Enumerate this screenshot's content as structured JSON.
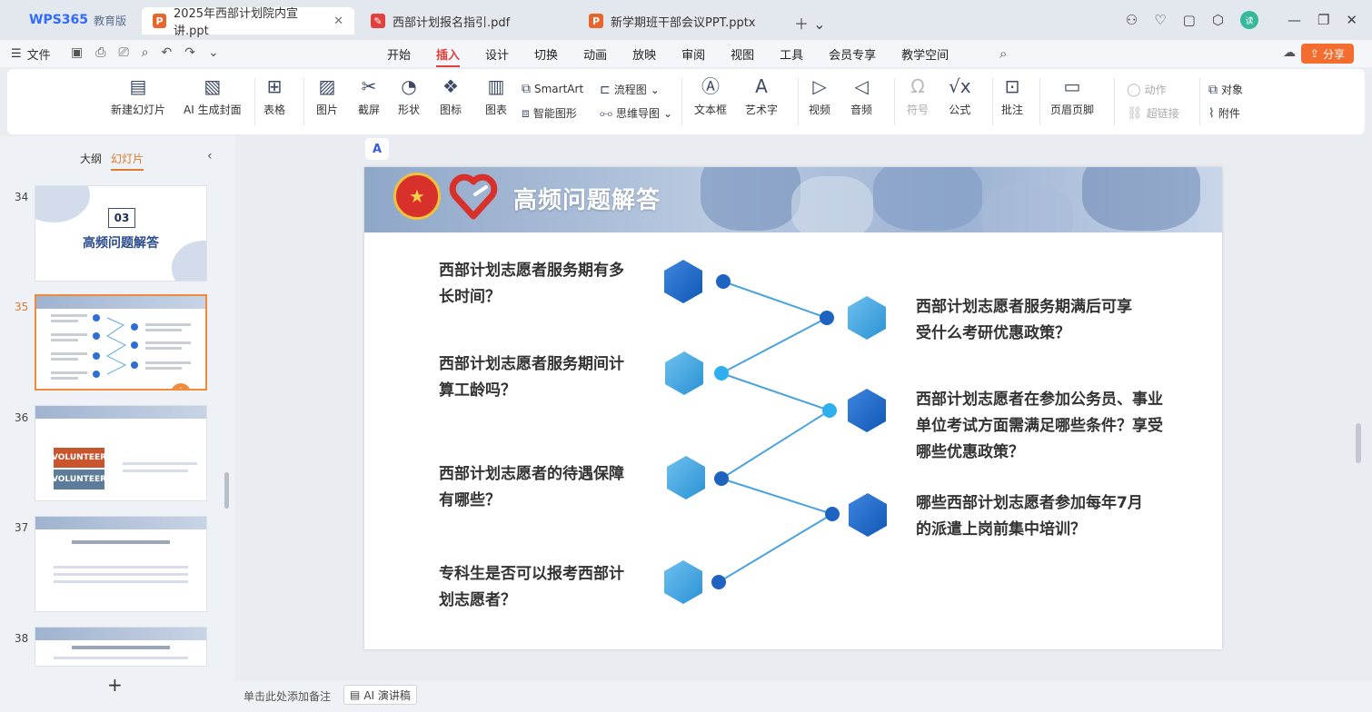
{
  "tabs": {
    "brand": "WPS365",
    "brand_sub": "教育版",
    "docs": [
      {
        "label": "2025年西部计划院内宣讲.ppt",
        "type": "P"
      },
      {
        "label": "西部计划报名指引.pdf",
        "type": "pdf"
      },
      {
        "label": "新学期班干部会议PPT.pptx",
        "type": "P"
      }
    ]
  },
  "menu": {
    "file": "文件",
    "tabs": [
      "开始",
      "插入",
      "设计",
      "切换",
      "动画",
      "放映",
      "审阅",
      "视图",
      "工具",
      "会员专享",
      "教学空间"
    ],
    "active_tab": "插入",
    "share": "分享"
  },
  "ribbon": {
    "new_slide": "新建幻灯片",
    "ai_cover": "AI 生成封面",
    "table": "表格",
    "picture": "图片",
    "screenshot": "截屏",
    "shape": "形状",
    "icon": "图标",
    "chart": "图表",
    "smartart": "SmartArt",
    "smart_shape": "智能图形",
    "flowchart": "流程图",
    "mindmap": "思维导图",
    "textbox": "文本框",
    "wordart": "艺术字",
    "video": "视频",
    "audio": "音频",
    "symbol": "符号",
    "formula": "公式",
    "comment": "批注",
    "header_footer": "页眉页脚",
    "action": "动作",
    "hyperlink": "超链接",
    "object": "对象",
    "attachment": "附件"
  },
  "left_panel": {
    "tab_outline": "大纲",
    "tab_slides": "幻灯片",
    "slides": [
      {
        "num": "34",
        "section": "03",
        "title": "高频问题解答"
      },
      {
        "num": "35"
      },
      {
        "num": "36",
        "vol1": "VOLUNTEER",
        "vol2": "VOLUNTEER"
      },
      {
        "num": "37"
      },
      {
        "num": "38"
      }
    ],
    "add": "+"
  },
  "slide": {
    "title": "高频问题解答",
    "left_questions": [
      "西部计划志愿者服务期有多长时间？",
      "西部计划志愿者服务期间计算工龄吗？",
      "西部计划志愿者的待遇保障有哪些？",
      "专科生是否可以报考西部计划志愿者？"
    ],
    "right_questions": [
      "西部计划志愿者服务期满后可享受什么考研优惠政策？",
      "西部计划志愿者在参加公务员、事业单位考试方面需满足哪些条件？享受哪些优惠政策？",
      "哪些西部计划志愿者参加每年7月的派遣上岗前集中培训？"
    ]
  },
  "status": {
    "notes_placeholder": "单击此处添加备注",
    "ai_notes": "AI 演讲稿"
  }
}
